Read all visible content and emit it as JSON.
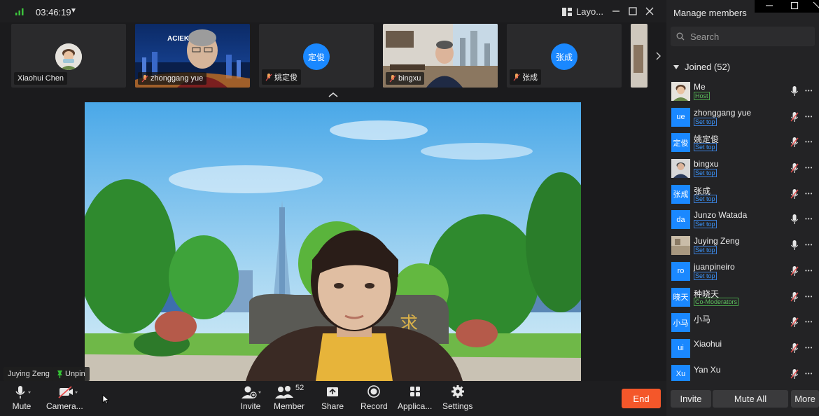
{
  "meeting": {
    "timer": "03:46:19",
    "layout_label": "Layo..."
  },
  "thumbnails": [
    {
      "name": "Xiaohui Chen",
      "type": "photo"
    },
    {
      "name": "zhonggang yue",
      "type": "video",
      "banner": "ACIEK"
    },
    {
      "name": "姚定俊",
      "type": "avatar",
      "initials": "定俊"
    },
    {
      "name": "bingxu",
      "type": "video"
    },
    {
      "name": "张成",
      "type": "avatar",
      "initials": "张成"
    }
  ],
  "main_video": {
    "speaker": "Juying Zeng",
    "unpin_label": "Unpin"
  },
  "toolbar": {
    "mute": "Mute",
    "camera": "Camera...",
    "invite": "Invite",
    "member": "Member",
    "member_count": "52",
    "share": "Share",
    "record": "Record",
    "apps": "Applica...",
    "settings": "Settings",
    "end": "End"
  },
  "panel": {
    "title": "Manage members",
    "search_placeholder": "Search",
    "joined_label": "Joined (52)",
    "members": [
      {
        "name": "Me",
        "role": "Host",
        "avatar": "photo",
        "mic": "on"
      },
      {
        "name": "zhonggang yue",
        "role": "Set top",
        "initials": "ue",
        "mic": "muted"
      },
      {
        "name": "姚定俊",
        "role": "Set top",
        "initials": "定俊",
        "mic": "muted"
      },
      {
        "name": "bingxu",
        "role": "Set top",
        "avatar": "photo",
        "mic": "muted"
      },
      {
        "name": "张成",
        "role": "Set top",
        "initials": "张成",
        "mic": "muted"
      },
      {
        "name": "Junzo Watada",
        "role": "Set top",
        "initials": "da",
        "mic": "on"
      },
      {
        "name": "Juying Zeng",
        "role": "Set top",
        "avatar": "photo",
        "mic": "on"
      },
      {
        "name": "juanpineiro",
        "role": "Set top",
        "initials": "ro",
        "mic": "muted"
      },
      {
        "name": "种晓天",
        "role": "Co-Moderators",
        "initials": "晓天",
        "mic": "muted"
      },
      {
        "name": "小马",
        "role": "",
        "initials": "小马",
        "mic": "muted"
      },
      {
        "name": "Xiaohui",
        "role": "",
        "initials": "ui",
        "mic": "muted"
      },
      {
        "name": "Yan Xu",
        "role": "",
        "initials": "Xu",
        "mic": "muted"
      }
    ],
    "invite_btn": "Invite",
    "mute_all_btn": "Mute All",
    "more_btn": "More"
  },
  "colors": {
    "accent": "#1a88ff",
    "end": "#f4572a",
    "background": "#1b1b1d"
  }
}
